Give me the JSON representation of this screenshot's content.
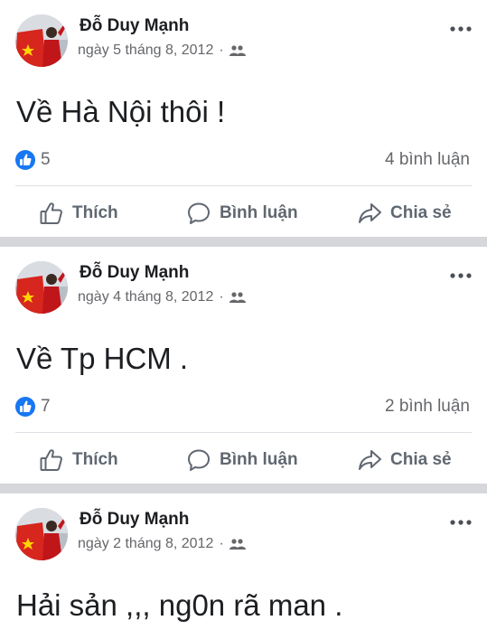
{
  "colors": {
    "facebook_blue": "#1877f2",
    "text_primary": "#1c1e21",
    "text_secondary": "#65676b",
    "action_text": "#606770",
    "separator": "#d5d7db"
  },
  "icons": {
    "more": "three-dots-horizontal-icon",
    "audience": "friends-icon",
    "like_badge": "thumbs-up-badge-icon",
    "like": "thumbs-up-outline-icon",
    "comment": "speech-bubble-icon",
    "share": "share-arrow-icon"
  },
  "posts": [
    {
      "author": "Đỗ Duy Mạnh",
      "date": "ngày 5 tháng 8, 2012",
      "separator": "·",
      "text": "Về Hà Nội thôi !",
      "reactions": "5",
      "comments": "4 bình luận",
      "actions": {
        "like": "Thích",
        "comment": "Bình luận",
        "share": "Chia sẻ"
      }
    },
    {
      "author": "Đỗ Duy Mạnh",
      "date": "ngày 4 tháng 8, 2012",
      "separator": "·",
      "text": "Về Tp HCM .",
      "reactions": "7",
      "comments": "2 bình luận",
      "actions": {
        "like": "Thích",
        "comment": "Bình luận",
        "share": "Chia sẻ"
      }
    },
    {
      "author": "Đỗ Duy Mạnh",
      "date": "ngày 2 tháng 8, 2012",
      "separator": "·",
      "text": "Hải sản ,,, ng0n rã man ."
    }
  ]
}
